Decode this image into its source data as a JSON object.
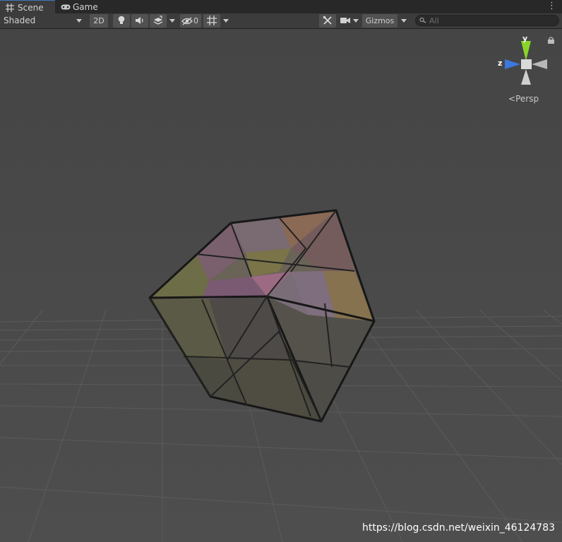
{
  "tabs": [
    {
      "label": "Scene",
      "icon": "grid-icon",
      "active": true
    },
    {
      "label": "Game",
      "icon": "gamepad-icon",
      "active": false
    }
  ],
  "toolbar": {
    "draw_mode": "Shaded",
    "mode_2d": "2D",
    "hidden_count": "0",
    "gizmos": "Gizmos",
    "search_placeholder": "All"
  },
  "gizmo": {
    "projection": "Persp",
    "axis_y": "y",
    "axis_z": "z"
  },
  "watermark": "https://blog.csdn.net/weixin_46124783",
  "colors": {
    "tab_bar": "#282828",
    "toolbar": "#3c3c3c",
    "viewport": "#474747",
    "gizmo_y": "#8ad52a",
    "gizmo_z": "#3d78e0"
  }
}
